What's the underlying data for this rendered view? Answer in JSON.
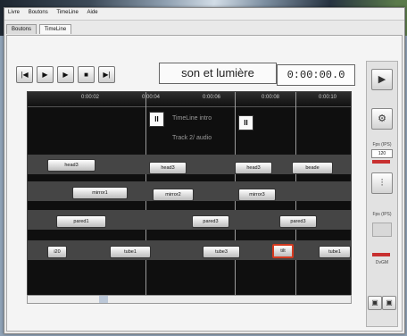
{
  "menu": [
    "Livre",
    "Boutons",
    "TimeLine",
    "Aide"
  ],
  "tabs": [
    "Boutons",
    "TimeLine"
  ],
  "transport": {
    "buttons": [
      "|◀",
      "▶",
      "▶",
      "■",
      "▶|"
    ]
  },
  "project_title": "son et lumière",
  "timecode": "0:00:00.0",
  "ruler_labels": [
    "0:00:02",
    "0:00:04",
    "0:00:06",
    "0:00:08",
    "0:00:10"
  ],
  "track_labels": [
    "TimeLine intro",
    "Track 2/ audio"
  ],
  "pause_symbol": "II",
  "clips": [
    {
      "row": 1,
      "label": "head3"
    },
    {
      "row": 1,
      "label": "head3"
    },
    {
      "row": 1,
      "label": "head3"
    },
    {
      "row": 1,
      "label": "beade"
    },
    {
      "row": 2,
      "label": "mirror1"
    },
    {
      "row": 2,
      "label": "mirror2"
    },
    {
      "row": 2,
      "label": "mirror3"
    },
    {
      "row": 3,
      "label": "pared1"
    },
    {
      "row": 3,
      "label": "pared3"
    },
    {
      "row": 3,
      "label": "pared3"
    },
    {
      "row": 4,
      "label": "i20"
    },
    {
      "row": 4,
      "label": "tube1"
    },
    {
      "row": 4,
      "label": "tube3"
    },
    {
      "row": 4,
      "label": "tilt"
    },
    {
      "row": 4,
      "label": "tube1"
    }
  ],
  "right_panel": {
    "fps_label": "Fps (IPS)",
    "fps_value": "120",
    "fps2_label": "Fps (IPS)",
    "checkbox_label": "DvGM"
  }
}
